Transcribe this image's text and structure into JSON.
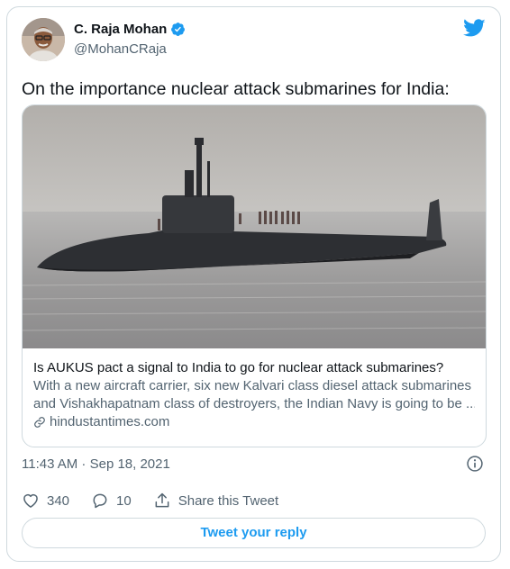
{
  "author": {
    "name": "C. Raja Mohan",
    "handle": "@MohanCRaja",
    "verified": true
  },
  "tweet": {
    "text": "On the importance nuclear attack submarines for India:",
    "timestamp": "11:43 AM · Sep 18, 2021"
  },
  "link_card": {
    "title": "Is AUKUS pact a signal to India to go for nuclear attack submarines?",
    "description_line1": "With a new aircraft carrier, six new Kalvari class diesel attack submarines",
    "description_line2": "and Vishakhapatnam class of destroyers, the Indian Navy is going to be ...",
    "domain": "hindustantimes.com"
  },
  "actions": {
    "likes": "340",
    "replies": "10",
    "share_label": "Share this Tweet"
  },
  "reply_button": {
    "label": "Tweet your reply"
  },
  "colors": {
    "accent": "#1d9bf0",
    "text": "#0f1419",
    "secondary": "#536471",
    "border": "#cfd9de"
  },
  "icons": [
    "verified-badge-icon",
    "twitter-bird-icon",
    "link-icon",
    "info-icon",
    "heart-icon",
    "reply-bubble-icon",
    "share-icon"
  ]
}
